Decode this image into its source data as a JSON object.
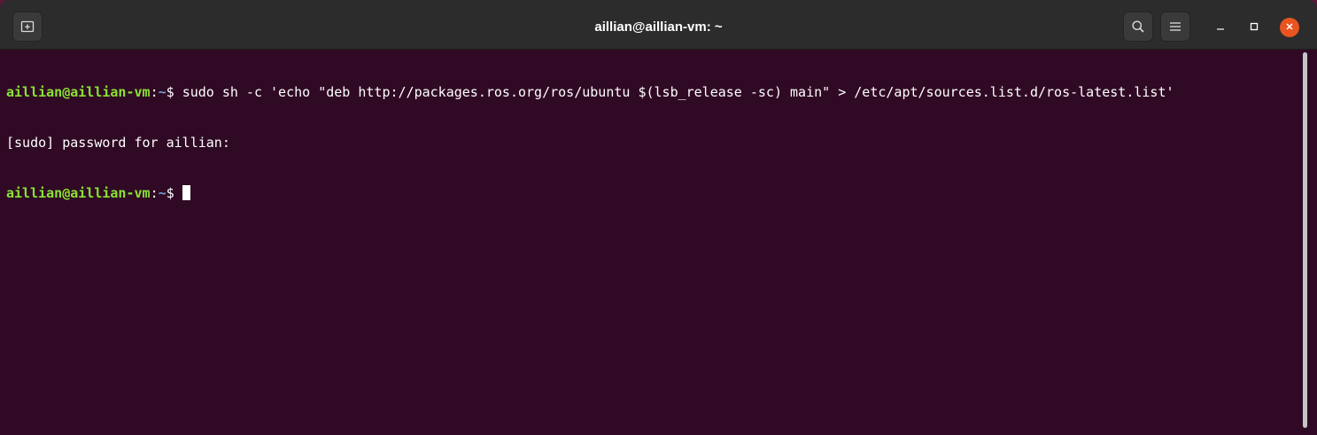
{
  "window": {
    "title": "aillian@aillian-vm: ~"
  },
  "toolbar": {
    "new_tab_icon": "new-tab-icon",
    "search_icon": "search-icon",
    "menu_icon": "hamburger-menu-icon",
    "minimize_icon": "minimize-icon",
    "maximize_icon": "maximize-icon",
    "close_icon": "close-icon"
  },
  "terminal": {
    "lines": [
      {
        "user_host": "aillian@aillian-vm",
        "sep": ":",
        "path": "~",
        "prompt": "$ ",
        "command": "sudo sh -c 'echo \"deb http://packages.ros.org/ros/ubuntu $(lsb_release -sc) main\" > /etc/apt/sources.list.d/ros-latest.list'"
      },
      {
        "output": "[sudo] password for aillian:"
      },
      {
        "user_host": "aillian@aillian-vm",
        "sep": ":",
        "path": "~",
        "prompt": "$ "
      }
    ]
  },
  "colors": {
    "background": "#300a24",
    "titlebar": "#2c2c2c",
    "prompt_user": "#8ae234",
    "prompt_path": "#729fcf",
    "close_button": "#e95420"
  }
}
